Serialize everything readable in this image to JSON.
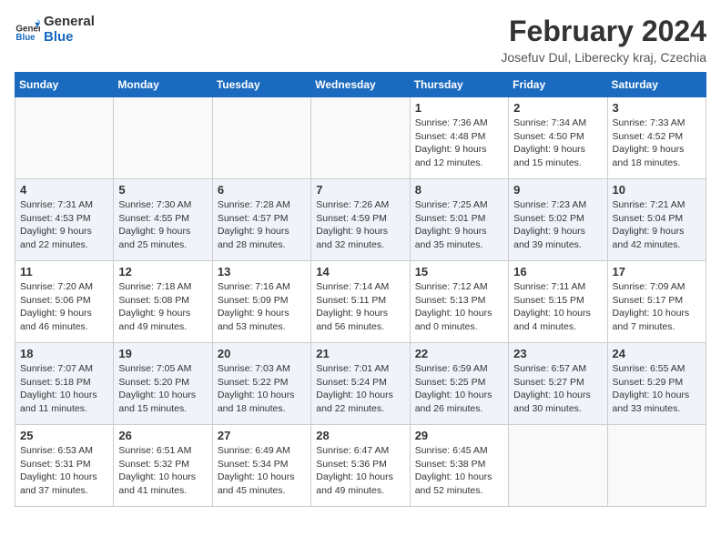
{
  "logo": {
    "text_general": "General",
    "text_blue": "Blue"
  },
  "title": {
    "month_year": "February 2024",
    "location": "Josefuv Dul, Liberecky kraj, Czechia"
  },
  "weekdays": [
    "Sunday",
    "Monday",
    "Tuesday",
    "Wednesday",
    "Thursday",
    "Friday",
    "Saturday"
  ],
  "weeks": [
    [
      {
        "day": "",
        "info": ""
      },
      {
        "day": "",
        "info": ""
      },
      {
        "day": "",
        "info": ""
      },
      {
        "day": "",
        "info": ""
      },
      {
        "day": "1",
        "info": "Sunrise: 7:36 AM\nSunset: 4:48 PM\nDaylight: 9 hours\nand 12 minutes."
      },
      {
        "day": "2",
        "info": "Sunrise: 7:34 AM\nSunset: 4:50 PM\nDaylight: 9 hours\nand 15 minutes."
      },
      {
        "day": "3",
        "info": "Sunrise: 7:33 AM\nSunset: 4:52 PM\nDaylight: 9 hours\nand 18 minutes."
      }
    ],
    [
      {
        "day": "4",
        "info": "Sunrise: 7:31 AM\nSunset: 4:53 PM\nDaylight: 9 hours\nand 22 minutes."
      },
      {
        "day": "5",
        "info": "Sunrise: 7:30 AM\nSunset: 4:55 PM\nDaylight: 9 hours\nand 25 minutes."
      },
      {
        "day": "6",
        "info": "Sunrise: 7:28 AM\nSunset: 4:57 PM\nDaylight: 9 hours\nand 28 minutes."
      },
      {
        "day": "7",
        "info": "Sunrise: 7:26 AM\nSunset: 4:59 PM\nDaylight: 9 hours\nand 32 minutes."
      },
      {
        "day": "8",
        "info": "Sunrise: 7:25 AM\nSunset: 5:01 PM\nDaylight: 9 hours\nand 35 minutes."
      },
      {
        "day": "9",
        "info": "Sunrise: 7:23 AM\nSunset: 5:02 PM\nDaylight: 9 hours\nand 39 minutes."
      },
      {
        "day": "10",
        "info": "Sunrise: 7:21 AM\nSunset: 5:04 PM\nDaylight: 9 hours\nand 42 minutes."
      }
    ],
    [
      {
        "day": "11",
        "info": "Sunrise: 7:20 AM\nSunset: 5:06 PM\nDaylight: 9 hours\nand 46 minutes."
      },
      {
        "day": "12",
        "info": "Sunrise: 7:18 AM\nSunset: 5:08 PM\nDaylight: 9 hours\nand 49 minutes."
      },
      {
        "day": "13",
        "info": "Sunrise: 7:16 AM\nSunset: 5:09 PM\nDaylight: 9 hours\nand 53 minutes."
      },
      {
        "day": "14",
        "info": "Sunrise: 7:14 AM\nSunset: 5:11 PM\nDaylight: 9 hours\nand 56 minutes."
      },
      {
        "day": "15",
        "info": "Sunrise: 7:12 AM\nSunset: 5:13 PM\nDaylight: 10 hours\nand 0 minutes."
      },
      {
        "day": "16",
        "info": "Sunrise: 7:11 AM\nSunset: 5:15 PM\nDaylight: 10 hours\nand 4 minutes."
      },
      {
        "day": "17",
        "info": "Sunrise: 7:09 AM\nSunset: 5:17 PM\nDaylight: 10 hours\nand 7 minutes."
      }
    ],
    [
      {
        "day": "18",
        "info": "Sunrise: 7:07 AM\nSunset: 5:18 PM\nDaylight: 10 hours\nand 11 minutes."
      },
      {
        "day": "19",
        "info": "Sunrise: 7:05 AM\nSunset: 5:20 PM\nDaylight: 10 hours\nand 15 minutes."
      },
      {
        "day": "20",
        "info": "Sunrise: 7:03 AM\nSunset: 5:22 PM\nDaylight: 10 hours\nand 18 minutes."
      },
      {
        "day": "21",
        "info": "Sunrise: 7:01 AM\nSunset: 5:24 PM\nDaylight: 10 hours\nand 22 minutes."
      },
      {
        "day": "22",
        "info": "Sunrise: 6:59 AM\nSunset: 5:25 PM\nDaylight: 10 hours\nand 26 minutes."
      },
      {
        "day": "23",
        "info": "Sunrise: 6:57 AM\nSunset: 5:27 PM\nDaylight: 10 hours\nand 30 minutes."
      },
      {
        "day": "24",
        "info": "Sunrise: 6:55 AM\nSunset: 5:29 PM\nDaylight: 10 hours\nand 33 minutes."
      }
    ],
    [
      {
        "day": "25",
        "info": "Sunrise: 6:53 AM\nSunset: 5:31 PM\nDaylight: 10 hours\nand 37 minutes."
      },
      {
        "day": "26",
        "info": "Sunrise: 6:51 AM\nSunset: 5:32 PM\nDaylight: 10 hours\nand 41 minutes."
      },
      {
        "day": "27",
        "info": "Sunrise: 6:49 AM\nSunset: 5:34 PM\nDaylight: 10 hours\nand 45 minutes."
      },
      {
        "day": "28",
        "info": "Sunrise: 6:47 AM\nSunset: 5:36 PM\nDaylight: 10 hours\nand 49 minutes."
      },
      {
        "day": "29",
        "info": "Sunrise: 6:45 AM\nSunset: 5:38 PM\nDaylight: 10 hours\nand 52 minutes."
      },
      {
        "day": "",
        "info": ""
      },
      {
        "day": "",
        "info": ""
      }
    ]
  ]
}
